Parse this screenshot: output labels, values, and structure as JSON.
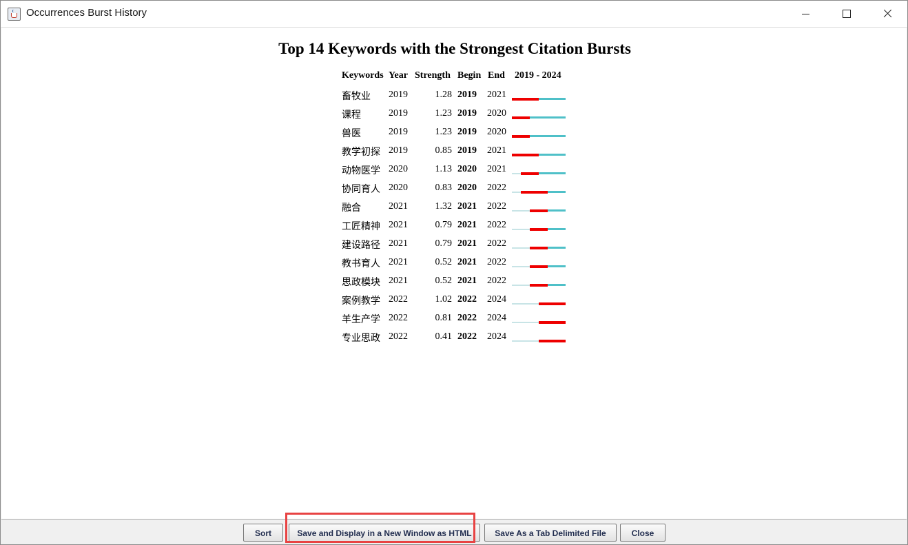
{
  "window": {
    "title": "Occurrences Burst History"
  },
  "report": {
    "title": "Top 14 Keywords with the Strongest Citation Bursts",
    "columns": {
      "keywords": "Keywords",
      "year": "Year",
      "strength": "Strength",
      "begin": "Begin",
      "end": "End",
      "range": "2019 - 2024"
    },
    "rows": [
      {
        "keyword": "畜牧业",
        "year": "2019",
        "strength": "1.28",
        "begin": "2019",
        "end": "2021"
      },
      {
        "keyword": "课程",
        "year": "2019",
        "strength": "1.23",
        "begin": "2019",
        "end": "2020"
      },
      {
        "keyword": "兽医",
        "year": "2019",
        "strength": "1.23",
        "begin": "2019",
        "end": "2020"
      },
      {
        "keyword": "教学初探",
        "year": "2019",
        "strength": "0.85",
        "begin": "2019",
        "end": "2021"
      },
      {
        "keyword": "动物医学",
        "year": "2020",
        "strength": "1.13",
        "begin": "2020",
        "end": "2021"
      },
      {
        "keyword": "协同育人",
        "year": "2020",
        "strength": "0.83",
        "begin": "2020",
        "end": "2022"
      },
      {
        "keyword": "融合",
        "year": "2021",
        "strength": "1.32",
        "begin": "2021",
        "end": "2022"
      },
      {
        "keyword": "工匠精神",
        "year": "2021",
        "strength": "0.79",
        "begin": "2021",
        "end": "2022"
      },
      {
        "keyword": "建设路径",
        "year": "2021",
        "strength": "0.79",
        "begin": "2021",
        "end": "2022"
      },
      {
        "keyword": "教书育人",
        "year": "2021",
        "strength": "0.52",
        "begin": "2021",
        "end": "2022"
      },
      {
        "keyword": "思政模块",
        "year": "2021",
        "strength": "0.52",
        "begin": "2021",
        "end": "2022"
      },
      {
        "keyword": "案例教学",
        "year": "2022",
        "strength": "1.02",
        "begin": "2022",
        "end": "2024"
      },
      {
        "keyword": "羊生产学",
        "year": "2022",
        "strength": "0.81",
        "begin": "2022",
        "end": "2024"
      },
      {
        "keyword": "专业思政",
        "year": "2022",
        "strength": "0.41",
        "begin": "2022",
        "end": "2024"
      }
    ],
    "timeline": {
      "start": 2019,
      "end": 2024
    },
    "colors": {
      "burst": "#ee0000",
      "after": "#4fc0c8",
      "before": "#c8e4e6"
    }
  },
  "buttons": {
    "sort": "Sort",
    "save_html": "Save and Display in a New Window as HTML",
    "save_tab": "Save As a Tab Delimited File",
    "close": "Close"
  }
}
